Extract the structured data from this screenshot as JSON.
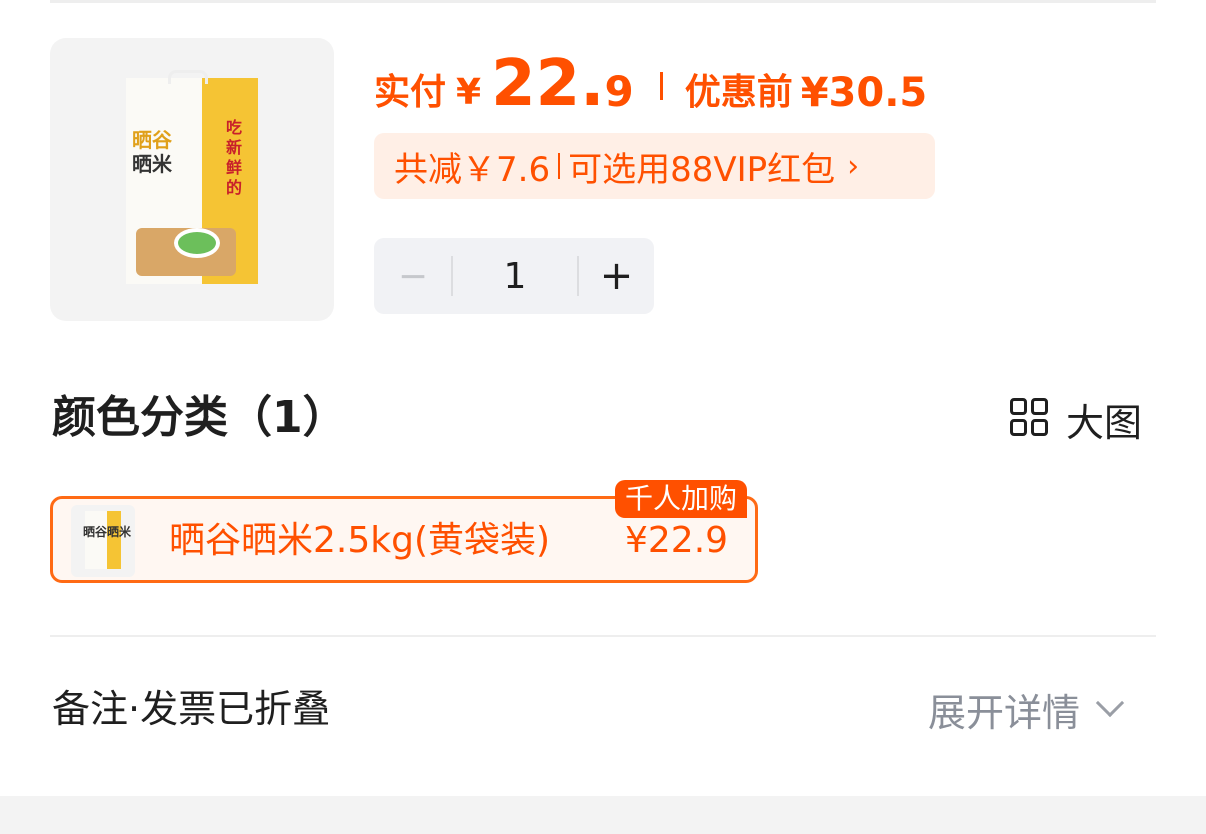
{
  "product": {
    "image_alt": "晒谷晒米",
    "bag_title_1": "晒谷",
    "bag_title_2": "晒米",
    "bag_slogan": "吃新鲜的"
  },
  "price": {
    "paid_label": "实付",
    "paid_currency": "¥",
    "paid_integer": "22.",
    "paid_decimal": "9",
    "original_label": "优惠前",
    "original_price": "¥30.5"
  },
  "promo": {
    "saving": "共减￥7.6",
    "coupon": "可选用88VIP红包",
    "arrow": "›"
  },
  "stepper": {
    "minus": "−",
    "quantity": "1",
    "plus": "+"
  },
  "variants": {
    "title": "颜色分类（1）",
    "big_image_label": "大图",
    "items": [
      {
        "name": "晒谷晒米2.5kg(黄袋装)",
        "price": "¥22.9",
        "badge": "千人加购",
        "thumb_text": "晒谷晒米",
        "selected": true
      }
    ]
  },
  "remarks": {
    "label": "备注·发票已折叠",
    "expand_label": "展开详情"
  },
  "colors": {
    "accent": "#ff5000",
    "promo_bg": "#ffefe6",
    "card_border": "#ff6a14",
    "muted": "#8a8f99"
  }
}
